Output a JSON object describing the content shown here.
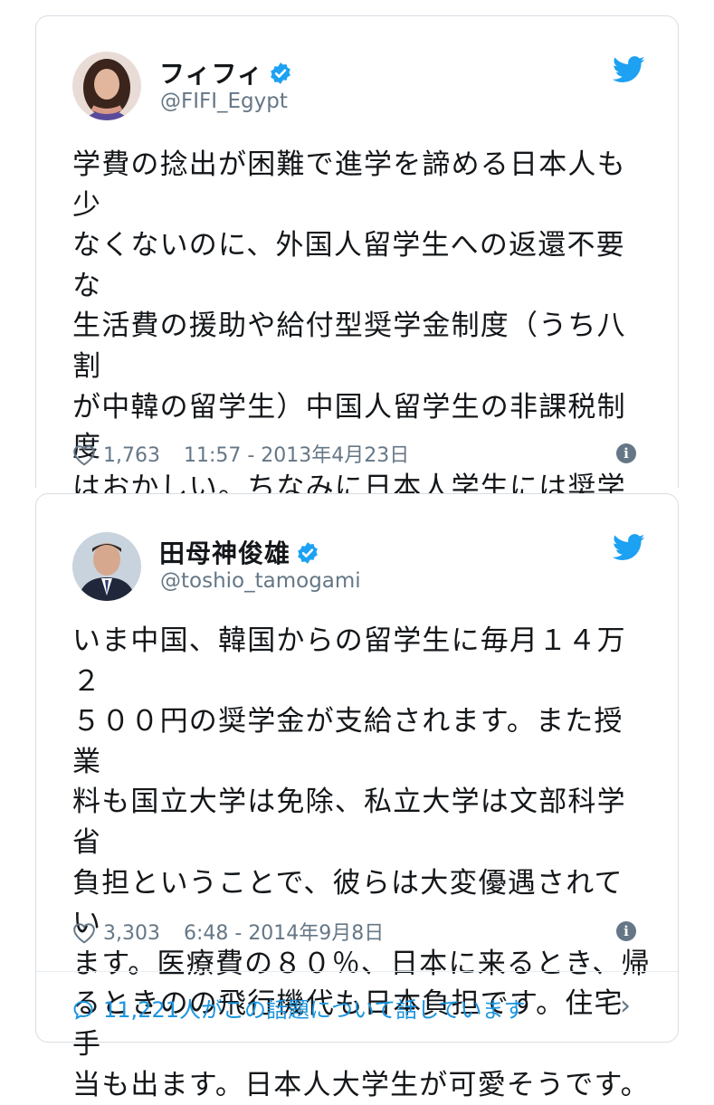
{
  "tweets": [
    {
      "name": "フィフィ",
      "handle": "@FIFI_Egypt",
      "text": "学費の捻出が困難で進学を諦める日本人も少\nなくないのに、外国人留学生への返還不要な\n生活費の援助や給付型奨学金制度（うち八割\nが中韓の留学生）中国人留学生の非課税制度\nはおかしい。ちなみに日本人学生には奨学金\nの返還義務がある。日本人学生に対する逆差\n別？だいたい皆さんこの事を知ってました？",
      "likes": "1,763",
      "timestamp": "11:57 - 2013年4月23日"
    },
    {
      "name": "田母神俊雄",
      "handle": "@toshio_tamogami",
      "text": "いま中国、韓国からの留学生に毎月１４万２\n５００円の奨学金が支給されます。また授業\n料も国立大学は免除、私立大学は文部科学省\n負担ということで、彼らは大変優遇されてい\nます。医療費の８０％、日本に来るとき、帰\nるときのの飛行機代も日本負担です。住宅手\n当も出ます。日本人大学生が可愛そうです。",
      "likes": "3,303",
      "timestamp": "6:48 - 2014年9月8日"
    }
  ],
  "conversation": {
    "label": "11,221人がこの話題について話しています",
    "chevron": "›"
  },
  "info_glyph": "i",
  "colors": {
    "twitter_blue": "#1da1f2",
    "link_blue": "#1b95e0",
    "meta_gray": "#657786",
    "border": "#d9dde2"
  },
  "icons": [
    "verified-badge-icon",
    "twitter-bird-icon",
    "heart-icon",
    "info-icon",
    "speech-bubble-icon",
    "chevron-right-icon"
  ]
}
